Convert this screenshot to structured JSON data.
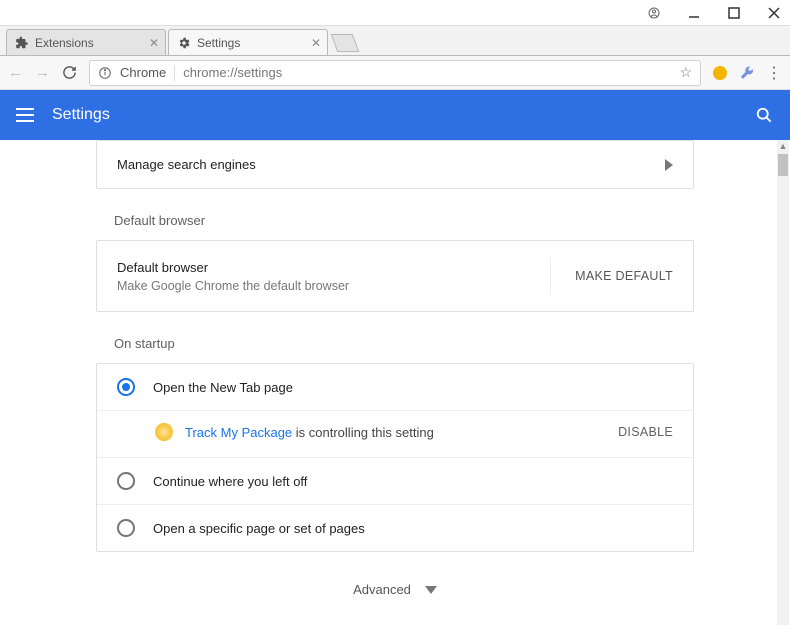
{
  "window": {
    "tabs": [
      {
        "label": "Extensions",
        "active": false
      },
      {
        "label": "Settings",
        "active": true
      }
    ]
  },
  "omnibox": {
    "chip": "Chrome",
    "url": "chrome://settings"
  },
  "header": {
    "title": "Settings"
  },
  "manage_engines": "Manage search engines",
  "default_browser_section": "Default browser",
  "default_browser": {
    "title": "Default browser",
    "subtitle": "Make Google Chrome the default browser",
    "button": "MAKE DEFAULT"
  },
  "startup_section": "On startup",
  "startup": {
    "opt1": "Open the New Tab page",
    "opt2": "Continue where you left off",
    "opt3": "Open a specific page or set of pages",
    "notice_link": "Track My Package",
    "notice_suffix": " is controlling this setting",
    "disable": "DISABLE"
  },
  "advanced": "Advanced"
}
